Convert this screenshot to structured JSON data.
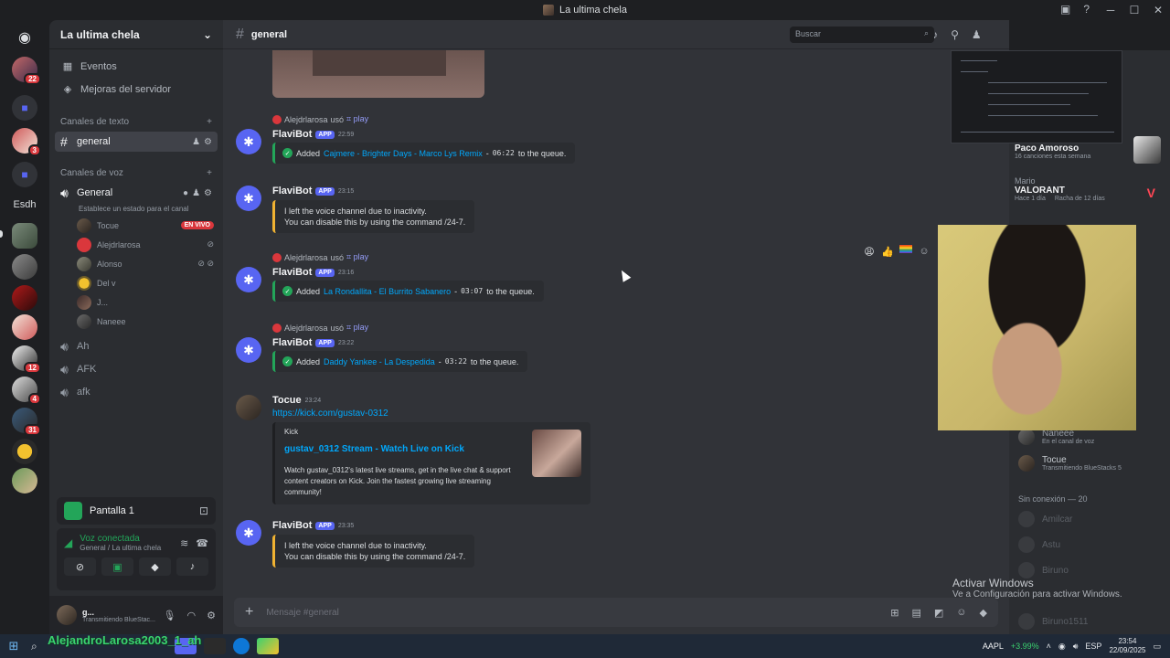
{
  "window": {
    "title": "La ultima chela"
  },
  "rail": {
    "badges": [
      "22",
      "3",
      "12",
      "4",
      "31"
    ],
    "text_server": "Esdh"
  },
  "sidebar": {
    "guild_name": "La ultima chela",
    "links": [
      {
        "label": "Eventos",
        "icon": "calendar-icon"
      },
      {
        "label": "Mejoras del servidor",
        "icon": "boost-icon"
      }
    ],
    "text_category": "Canales de texto",
    "text_channels": [
      {
        "name": "general"
      }
    ],
    "voice_category": "Canales de voz",
    "voice_channel": {
      "name": "General",
      "status_placeholder": "Establece un estado para el canal"
    },
    "voice_users": [
      {
        "name": "Tocue",
        "live": "EN VIVO"
      },
      {
        "name": "Alejdrlarosa"
      },
      {
        "name": "Alonso"
      },
      {
        "name": "Del v"
      },
      {
        "name": "J..."
      },
      {
        "name": "Naneee"
      }
    ],
    "other_voice": [
      "Ah",
      "AFK",
      "afk"
    ],
    "screen_share": {
      "label": "Pantalla 1"
    },
    "connection": {
      "status": "Voz conectada",
      "location": "General / La ultima chela"
    },
    "user": {
      "name": "g...",
      "status": "Transmitiendo BlueStac..."
    }
  },
  "chat": {
    "channel": "general",
    "search_placeholder": "Buscar",
    "composer_placeholder": "Mensaje #general",
    "messages": [
      {
        "reply_user": "Alejdrlarosa",
        "reply_verb": "usó",
        "reply_cmd": "⌗ play",
        "author": "FlaviBot",
        "tag": "APP",
        "time": "22:59",
        "pre": "Added",
        "song": "Cajmere - Brighter Days - Marco Lys Remix",
        "sep": "-",
        "duration": "06:22",
        "post": "to the queue."
      },
      {
        "author": "FlaviBot",
        "tag": "APP",
        "time": "23:15",
        "line1": "I left the voice channel due to inactivity.",
        "line2": "You can disable this by using the command /24-7."
      },
      {
        "reply_user": "Alejdrlarosa",
        "reply_verb": "usó",
        "reply_cmd": "⌗ play",
        "author": "FlaviBot",
        "tag": "APP",
        "time": "23:16",
        "pre": "Added",
        "song": "La Rondallita - El Burrito Sabanero",
        "sep": "-",
        "duration": "03:07",
        "post": "to the queue."
      },
      {
        "reply_user": "Alejdrlarosa",
        "reply_verb": "usó",
        "reply_cmd": "⌗ play",
        "author": "FlaviBot",
        "tag": "APP",
        "time": "23:22",
        "pre": "Added",
        "song": "Daddy Yankee - La Despedida",
        "sep": "-",
        "duration": "03:22",
        "post": "to the queue."
      },
      {
        "author": "Tocue",
        "time": "23:24",
        "link": "https://kick.com/gustav-0312",
        "embed_provider": "Kick",
        "embed_title": "gustav_0312 Stream - Watch Live on Kick",
        "embed_desc": "Watch gustav_0312's latest live streams, get in the live chat & support content creators on Kick. Join the fastest growing live streaming community!"
      },
      {
        "author": "FlaviBot",
        "tag": "APP",
        "time": "23:35",
        "line1": "I left the voice channel due to inactivity.",
        "line2": "You can disable this by using the command /24-7."
      }
    ]
  },
  "members": {
    "activity1": {
      "title": "Paco Amoroso",
      "sub": "16 canciones esta semana"
    },
    "activity2": {
      "user": "Mario",
      "game": "VALORANT",
      "sub1": "Hace 1 día",
      "sub2": "Racha de 12 días"
    },
    "rows": [
      {
        "name": "Naneee",
        "status": "En el canal de voz"
      },
      {
        "name": "Tocue",
        "status": "Transmitiendo BlueStacks 5"
      }
    ],
    "offline_title": "Sin conexión — 20",
    "offline": [
      "Amilcar",
      "Astu",
      "Biruno",
      "Biruno1511"
    ]
  },
  "watermark": {
    "title": "Activar Windows",
    "sub": "Ve a Configuración para activar Windows."
  },
  "taskbar": {
    "overlay_name": "AlejandroLarosa2003_1_ah",
    "stock_symbol": "AAPL",
    "stock_change": "+3.99%",
    "lang": "ESP",
    "time": "23:54",
    "date": "22/09/2025"
  }
}
